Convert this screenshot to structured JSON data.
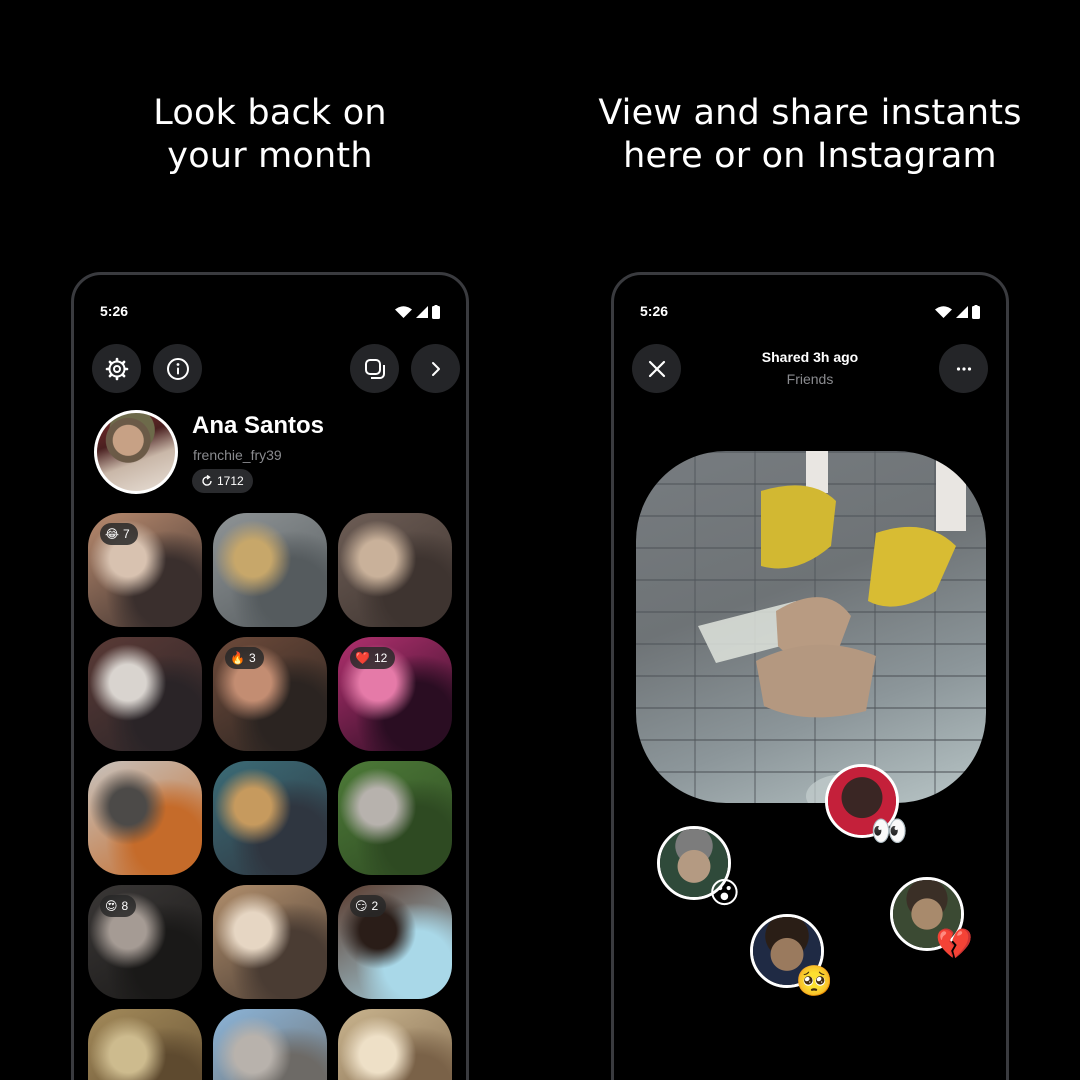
{
  "headlines": {
    "left": [
      "Look back on",
      "your month"
    ],
    "right": [
      "View and share instants",
      "here or on Instagram"
    ]
  },
  "left_phone": {
    "status_time": "5:26",
    "toolbar": {
      "settings_icon": "gear-icon",
      "info_icon": "info-icon",
      "gallery_icon": "stacked-squares-icon",
      "next_icon": "chevron-right-icon"
    },
    "profile": {
      "name": "Ana Santos",
      "handle": "frenchie_fry39",
      "count": "1712"
    },
    "tiles": [
      {
        "badge_emoji": "😂",
        "badge_count": "7",
        "colors": [
          "#b88a6e",
          "#3a2f2d",
          "#d8c2b0"
        ]
      },
      {
        "badge_emoji": "",
        "badge_count": "",
        "colors": [
          "#8f9496",
          "#555b5e",
          "#c7a76a"
        ]
      },
      {
        "badge_emoji": "",
        "badge_count": "",
        "colors": [
          "#6d5d55",
          "#3e3430",
          "#c9b19a"
        ]
      },
      {
        "badge_emoji": "",
        "badge_count": "",
        "colors": [
          "#5a3a36",
          "#2a2427",
          "#d9d4cf"
        ]
      },
      {
        "badge_emoji": "🔥",
        "badge_count": "3",
        "colors": [
          "#6d4a3a",
          "#2b2421",
          "#c38d72"
        ]
      },
      {
        "badge_emoji": "❤️",
        "badge_count": "12",
        "colors": [
          "#b0306e",
          "#2a0d22",
          "#e57aa8"
        ]
      },
      {
        "badge_emoji": "",
        "badge_count": "",
        "colors": [
          "#c7c2bd",
          "#c56b2a",
          "#4c4a48"
        ]
      },
      {
        "badge_emoji": "",
        "badge_count": "",
        "colors": [
          "#3b6c77",
          "#2f3640",
          "#c69a5e"
        ]
      },
      {
        "badge_emoji": "",
        "badge_count": "",
        "colors": [
          "#4d7a38",
          "#2e4a22",
          "#b7b2ad"
        ]
      },
      {
        "badge_emoji": "😍",
        "badge_count": "8",
        "colors": [
          "#3a3736",
          "#1a1918",
          "#a59b94"
        ]
      },
      {
        "badge_emoji": "",
        "badge_count": "",
        "colors": [
          "#b08e6c",
          "#4a3c33",
          "#e6d6c3"
        ]
      },
      {
        "badge_emoji": "😏",
        "badge_count": "2",
        "colors": [
          "#5b3c2f",
          "#a9d8e8",
          "#2a1d18"
        ]
      },
      {
        "badge_emoji": "",
        "badge_count": "",
        "colors": [
          "#a38a5a",
          "#5e4a2f",
          "#cdbb8e"
        ]
      },
      {
        "badge_emoji": "",
        "badge_count": "",
        "colors": [
          "#8bb4d8",
          "#6d6a66",
          "#b8b2ac"
        ]
      },
      {
        "badge_emoji": "",
        "badge_count": "",
        "colors": [
          "#c9b48e",
          "#7a6248",
          "#eee0c7"
        ]
      }
    ]
  },
  "right_phone": {
    "status_time": "5:26",
    "close_icon": "close-icon",
    "more_icon": "more-horizontal-icon",
    "shared_label": "Shared 3h ago",
    "audience_label": "Friends",
    "reactions": [
      {
        "emoji": "👀",
        "colors": [
          "#3a2624",
          "#c4203a"
        ]
      },
      {
        "emoji": "😮",
        "colors": [
          "#b49a82",
          "#2f4a3a"
        ]
      },
      {
        "emoji": "💔",
        "colors": [
          "#6b5a44",
          "#3b4a33"
        ]
      },
      {
        "emoji": "🥺",
        "colors": [
          "#9a7a5e",
          "#1f2a44"
        ]
      }
    ]
  }
}
